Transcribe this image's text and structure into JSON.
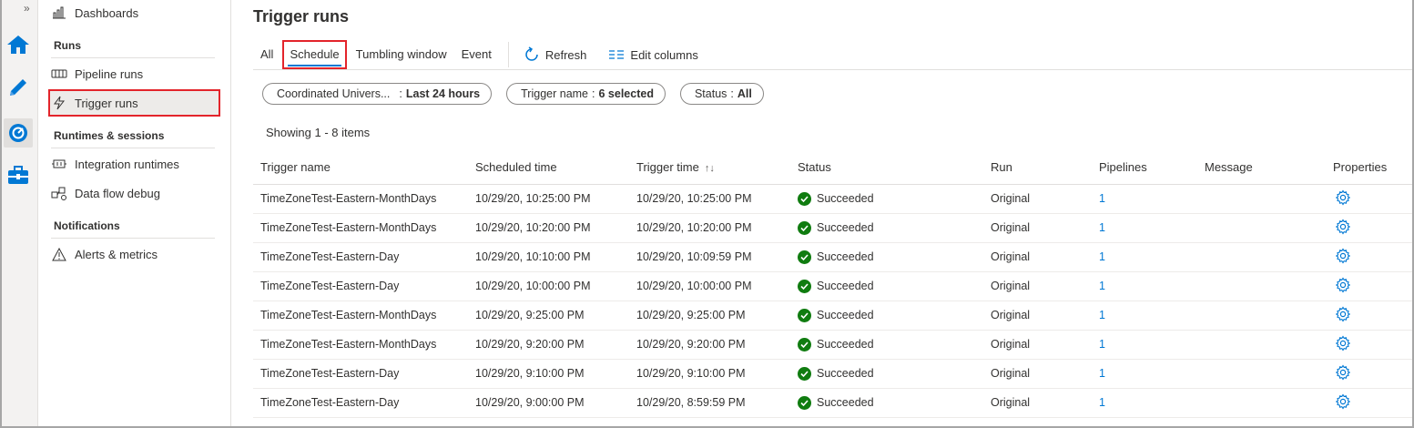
{
  "rail": {
    "expand": "»",
    "items": [
      {
        "name": "home-icon"
      },
      {
        "name": "author-pencil-icon"
      },
      {
        "name": "monitor-gauge-icon"
      },
      {
        "name": "manage-toolbox-icon"
      }
    ]
  },
  "nav": {
    "dashboards": "Dashboards",
    "runs_header": "Runs",
    "pipeline_runs": "Pipeline runs",
    "trigger_runs": "Trigger runs",
    "runtimes_header": "Runtimes & sessions",
    "integration_runtimes": "Integration runtimes",
    "data_flow_debug": "Data flow debug",
    "notifications_header": "Notifications",
    "alerts_metrics": "Alerts & metrics"
  },
  "page": {
    "title": "Trigger runs",
    "tabs": [
      "All",
      "Schedule",
      "Tumbling window",
      "Event"
    ],
    "active_tab": "Schedule",
    "refresh": "Refresh",
    "edit_columns": "Edit columns",
    "filters": [
      {
        "label": "Coordinated Univers...",
        "sep": ":",
        "value": "Last 24 hours"
      },
      {
        "label": "Trigger name",
        "sep": ":",
        "value": "6 selected"
      },
      {
        "label": "Status",
        "sep": ":",
        "value": "All"
      }
    ],
    "showing": "Showing 1 - 8 items"
  },
  "table": {
    "columns": [
      "Trigger name",
      "Scheduled time",
      "Trigger time",
      "Status",
      "Run",
      "Pipelines",
      "Message",
      "Properties"
    ],
    "sort_indicator": "↑↓",
    "rows": [
      {
        "trigger": "TimeZoneTest-Eastern-MonthDays",
        "scheduled": "10/29/20, 10:25:00 PM",
        "triggered": "10/29/20, 10:25:00 PM",
        "status": "Succeeded",
        "run": "Original",
        "pipelines": "1",
        "message": ""
      },
      {
        "trigger": "TimeZoneTest-Eastern-MonthDays",
        "scheduled": "10/29/20, 10:20:00 PM",
        "triggered": "10/29/20, 10:20:00 PM",
        "status": "Succeeded",
        "run": "Original",
        "pipelines": "1",
        "message": ""
      },
      {
        "trigger": "TimeZoneTest-Eastern-Day",
        "scheduled": "10/29/20, 10:10:00 PM",
        "triggered": "10/29/20, 10:09:59 PM",
        "status": "Succeeded",
        "run": "Original",
        "pipelines": "1",
        "message": ""
      },
      {
        "trigger": "TimeZoneTest-Eastern-Day",
        "scheduled": "10/29/20, 10:00:00 PM",
        "triggered": "10/29/20, 10:00:00 PM",
        "status": "Succeeded",
        "run": "Original",
        "pipelines": "1",
        "message": ""
      },
      {
        "trigger": "TimeZoneTest-Eastern-MonthDays",
        "scheduled": "10/29/20, 9:25:00 PM",
        "triggered": "10/29/20, 9:25:00 PM",
        "status": "Succeeded",
        "run": "Original",
        "pipelines": "1",
        "message": ""
      },
      {
        "trigger": "TimeZoneTest-Eastern-MonthDays",
        "scheduled": "10/29/20, 9:20:00 PM",
        "triggered": "10/29/20, 9:20:00 PM",
        "status": "Succeeded",
        "run": "Original",
        "pipelines": "1",
        "message": ""
      },
      {
        "trigger": "TimeZoneTest-Eastern-Day",
        "scheduled": "10/29/20, 9:10:00 PM",
        "triggered": "10/29/20, 9:10:00 PM",
        "status": "Succeeded",
        "run": "Original",
        "pipelines": "1",
        "message": ""
      },
      {
        "trigger": "TimeZoneTest-Eastern-Day",
        "scheduled": "10/29/20, 9:00:00 PM",
        "triggered": "10/29/20, 8:59:59 PM",
        "status": "Succeeded",
        "run": "Original",
        "pipelines": "1",
        "message": ""
      }
    ]
  },
  "colors": {
    "accent": "#0078d4",
    "success": "#107c10",
    "highlight": "#e3242b"
  }
}
